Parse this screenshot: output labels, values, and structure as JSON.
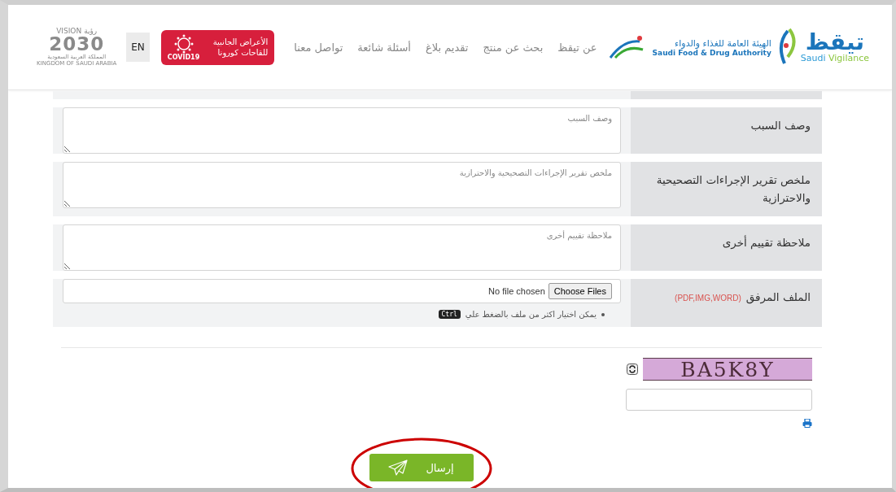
{
  "header": {
    "logo": {
      "name": "تيقظ",
      "subtitle_1": "Saudi",
      "subtitle_2": "Vigilance"
    },
    "authority": {
      "name_ar": "الهيئة العامة للغذاء والدواء",
      "name_en": "Saudi Food & Drug Authority"
    },
    "nav": [
      "عن تيقظ",
      "بحث عن منتج",
      "تقديم بلاغ",
      "أسئلة شائعة",
      "تواصل معنا"
    ],
    "covid_badge": {
      "text": "الأعراض الجانبية للقاحات كورونا",
      "caption": "COVID19"
    },
    "language": "EN",
    "vision": {
      "word_en": "VISION",
      "word_ar": "رؤية",
      "year": "2030",
      "country_ar": "المملكة العربية السعودية",
      "country_en": "KINGDOM OF SAUDI ARABIA"
    }
  },
  "form": {
    "rows": [
      {
        "kind": "textarea",
        "label": "وصف السبب",
        "placeholder": "وصف السبب"
      },
      {
        "kind": "textarea",
        "label": "ملخص تقرير الإجراءات التصحيحية والاحترازية",
        "placeholder": "ملخص تقرير الإجراءات التصحيحية والاحترازية"
      },
      {
        "kind": "textarea",
        "label": "ملاحظة تقييم أخرى",
        "placeholder": "ملاحظة تقييم أخرى"
      },
      {
        "kind": "file",
        "label": "الملف المرفق",
        "formats": "(PDF,IMG,WORD)",
        "button": "Choose Files",
        "status": "No file chosen",
        "note": "يمكن اختيار اكثر من ملف بالضغط علي",
        "key": "Ctrl"
      }
    ]
  },
  "captcha": {
    "text": "BA5K8Y"
  },
  "submit": {
    "label": "إرسال"
  }
}
